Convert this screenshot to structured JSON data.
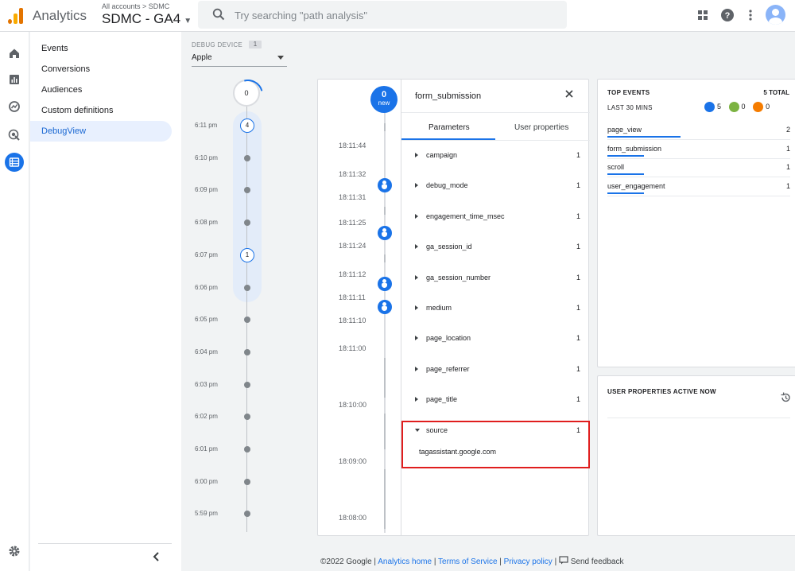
{
  "header": {
    "app_name": "Analytics",
    "breadcrumb": "All accounts > SDMC",
    "property": "SDMC - GA4",
    "search_placeholder": "Try searching \"path analysis\""
  },
  "icons": {
    "logo": "analytics-logo-icon",
    "search": "search-icon",
    "apps": "apps-grid-icon",
    "help": "help-icon",
    "more": "more-vert-icon",
    "account": "account-avatar-icon",
    "home": "home-icon",
    "reports": "reports-icon",
    "explore": "explore-icon",
    "advertising": "advertising-icon",
    "configure": "configure-icon",
    "settings": "gear-icon",
    "collapse": "chevron-left-icon",
    "close": "close-icon",
    "history": "history-icon",
    "feedback": "feedback-icon"
  },
  "colors": {
    "accent": "#1a73e8",
    "logo_orange": "#f9ab00",
    "logo_dark": "#e37400",
    "highlight": "#e01e1e",
    "green_badge": "#7cb342",
    "orange_badge": "#f57c00"
  },
  "subnav": {
    "items": [
      {
        "label": "Events"
      },
      {
        "label": "Conversions"
      },
      {
        "label": "Audiences"
      },
      {
        "label": "Custom definitions"
      },
      {
        "label": "DebugView"
      }
    ]
  },
  "debug_device": {
    "label": "DEBUG DEVICE",
    "count": "1",
    "selected": "Apple"
  },
  "minutes_stream": {
    "top_count": "0",
    "labels": [
      "6:11 pm",
      "6:10 pm",
      "6:09 pm",
      "6:08 pm",
      "6:07 pm",
      "6:06 pm",
      "6:05 pm",
      "6:04 pm",
      "6:03 pm",
      "6:02 pm",
      "6:01 pm",
      "6:00 pm",
      "5:59 pm"
    ],
    "counts": [
      {
        "minute": "6:11 pm",
        "value": "4"
      },
      {
        "minute": "6:07 pm",
        "value": "1"
      }
    ]
  },
  "seconds_stream": {
    "new_count": "0",
    "new_label": "new",
    "labels": [
      "18:11:44",
      "18:11:32",
      "18:11:31",
      "18:11:25",
      "18:11:24",
      "18:11:12",
      "18:11:11",
      "18:11:10",
      "18:11:00",
      "18:10:00",
      "18:09:00",
      "18:08:00"
    ]
  },
  "event_detail": {
    "title": "form_submission",
    "tabs": {
      "parameters": "Parameters",
      "user_properties": "User properties"
    },
    "parameters": [
      {
        "name": "campaign",
        "count": "1"
      },
      {
        "name": "debug_mode",
        "count": "1"
      },
      {
        "name": "engagement_time_msec",
        "count": "1"
      },
      {
        "name": "ga_session_id",
        "count": "1"
      },
      {
        "name": "ga_session_number",
        "count": "1"
      },
      {
        "name": "medium",
        "count": "1"
      },
      {
        "name": "page_location",
        "count": "1"
      },
      {
        "name": "page_referrer",
        "count": "1"
      },
      {
        "name": "page_title",
        "count": "1"
      },
      {
        "name": "source",
        "count": "1"
      }
    ],
    "source_value": "tagassistant.google.com"
  },
  "top_events": {
    "title": "TOP EVENTS",
    "total": "5 TOTAL",
    "subtitle": "LAST 30 MINS",
    "badge_counts": {
      "events": "5",
      "conversions": "0",
      "errors": "0"
    },
    "rows": [
      {
        "label": "page_view",
        "count": "2",
        "share": 0.4
      },
      {
        "label": "form_submission",
        "count": "1",
        "share": 0.2
      },
      {
        "label": "scroll",
        "count": "1",
        "share": 0.2
      },
      {
        "label": "user_engagement",
        "count": "1",
        "share": 0.2
      }
    ]
  },
  "user_properties": {
    "title": "USER PROPERTIES ACTIVE NOW"
  },
  "footer": {
    "copyright": "©2022 Google",
    "analytics_home": "Analytics home",
    "terms": "Terms of Service",
    "privacy": "Privacy policy",
    "feedback": "Send feedback"
  }
}
